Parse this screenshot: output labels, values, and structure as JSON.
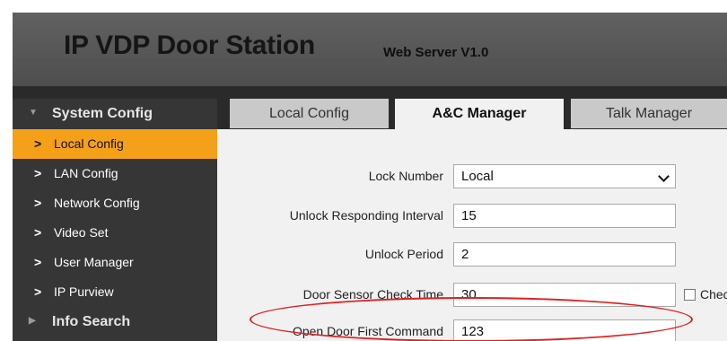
{
  "header": {
    "title": "IP VDP Door Station",
    "subtitle": "Web Server V1.0"
  },
  "sidebar": {
    "sections": [
      {
        "label": "System Config",
        "expanded": true
      },
      {
        "label": "Info Search",
        "expanded": false
      }
    ],
    "items": [
      {
        "label": "Local Config",
        "active": true
      },
      {
        "label": "LAN Config"
      },
      {
        "label": "Network Config"
      },
      {
        "label": "Video Set"
      },
      {
        "label": "User Manager"
      },
      {
        "label": "IP Purview"
      }
    ]
  },
  "tabs": [
    {
      "label": "Local Config"
    },
    {
      "label": "A&C Manager",
      "active": true
    },
    {
      "label": "Talk Manager"
    }
  ],
  "form": {
    "lock_number": {
      "label": "Lock Number",
      "value": "Local"
    },
    "unlock_interval": {
      "label": "Unlock Responding Interval",
      "value": "15"
    },
    "unlock_period": {
      "label": "Unlock Period",
      "value": "2"
    },
    "door_sensor": {
      "label": "Door Sensor Check Time",
      "value": "30",
      "checkbox_label": "Check"
    },
    "open_door_cmd": {
      "label": "Open Door First Command",
      "value": "123"
    }
  },
  "colors": {
    "accent": "#f4a018",
    "highlight": "#e02020"
  }
}
